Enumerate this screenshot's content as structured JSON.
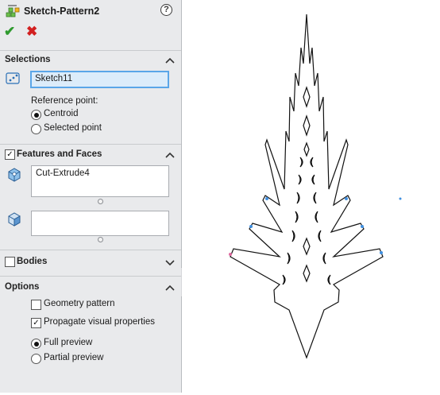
{
  "header": {
    "title": "Sketch-Pattern2",
    "help_icon": "question-mark-icon",
    "ok_icon": "checkmark-icon",
    "cancel_icon": "x-icon"
  },
  "selections": {
    "title": "Selections",
    "sketch_value": "Sketch11",
    "reference_label": "Reference point:",
    "options": [
      {
        "label": "Centroid",
        "selected": true
      },
      {
        "label": "Selected point",
        "selected": false
      }
    ]
  },
  "features": {
    "title": "Features and Faces",
    "checked": true,
    "features_list": [
      "Cut-Extrude4"
    ],
    "faces_list": []
  },
  "bodies": {
    "title": "Bodies",
    "checked": false
  },
  "options": {
    "title": "Options",
    "geometry_pattern": {
      "label": "Geometry pattern",
      "checked": false
    },
    "propagate": {
      "label": "Propagate visual properties",
      "checked": true
    },
    "full_preview": {
      "label": "Full preview",
      "selected": true
    },
    "partial_preview": {
      "label": "Partial preview",
      "selected": false
    }
  },
  "colors": {
    "accent": "#5aa6e8",
    "ok": "#2e9a2e",
    "cancel": "#d22020",
    "panel_bg": "#e9eaec"
  }
}
